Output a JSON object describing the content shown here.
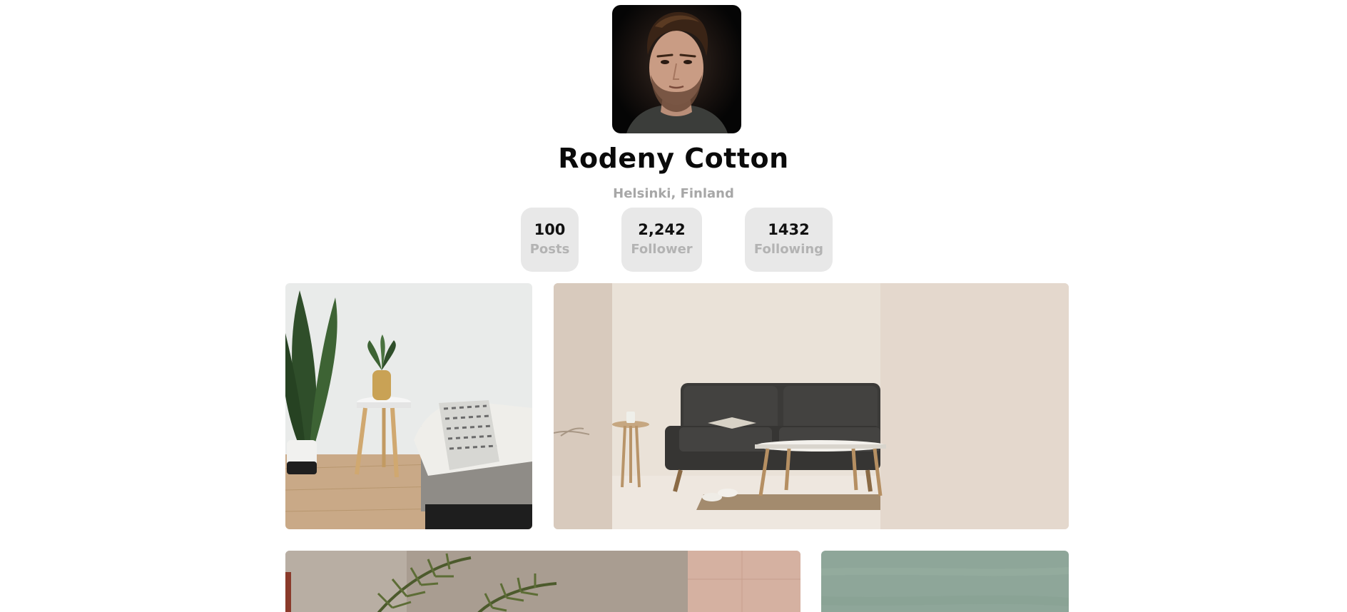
{
  "profile": {
    "name": "Rodeny Cotton",
    "location": "Helsinki, Finland"
  },
  "stats": [
    {
      "value": "100",
      "label": "Posts"
    },
    {
      "value": "2,242",
      "label": "Follower"
    },
    {
      "value": "1432",
      "label": "Following"
    }
  ],
  "gallery": [
    {
      "subject": "bedroom-plant-side-table-photo"
    },
    {
      "subject": "living-room-grey-sofa-photo"
    },
    {
      "subject": "stucco-wall-palm-photo"
    },
    {
      "subject": "sage-green-wall-photo"
    }
  ],
  "colors": {
    "background": "#ffffff",
    "stat_bg": "#e8e8e8",
    "muted_text": "#a7a7a7",
    "name_text": "#0a0a0a"
  }
}
